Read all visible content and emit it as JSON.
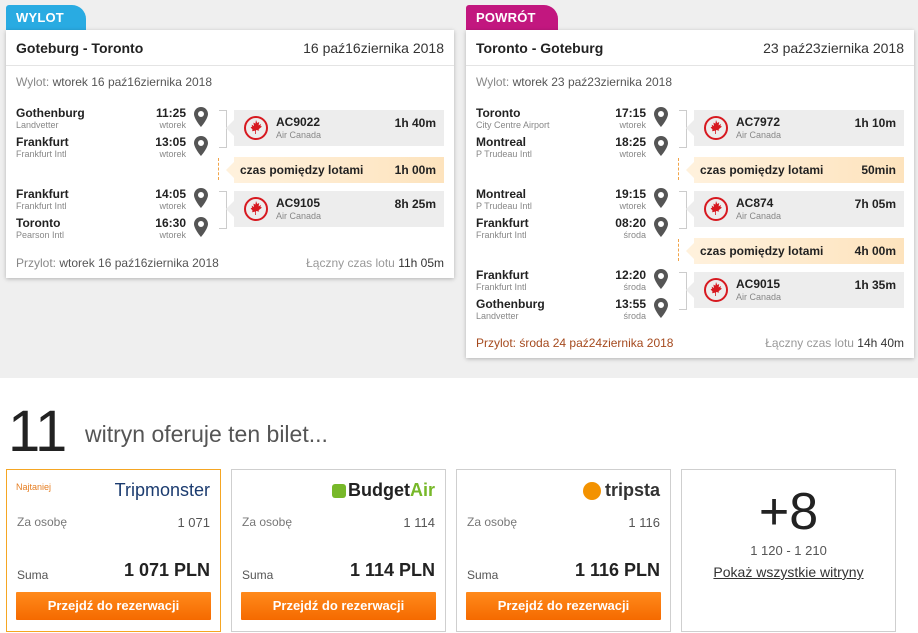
{
  "outbound": {
    "tag": "WYLOT",
    "route": "Goteburg - Toronto",
    "date": "16 paź16ziernika 2018",
    "departure_label": "Wylot:",
    "departure_value": "wtorek 16 paź16ziernika 2018",
    "arrival_label": "Przylot:",
    "arrival_value": "wtorek 16 paź16ziernika 2018",
    "total_label": "Łączny czas lotu",
    "total_value": "11h 05m",
    "stops": [
      {
        "city": "Gothenburg",
        "airport": "Landvetter",
        "time": "11:25",
        "day": "wtorek"
      },
      {
        "city": "Frankfurt",
        "airport": "Frankfurt Intl",
        "time": "13:05",
        "day": "wtorek"
      },
      {
        "city": "Frankfurt",
        "airport": "Frankfurt Intl",
        "time": "14:05",
        "day": "wtorek"
      },
      {
        "city": "Toronto",
        "airport": "Pearson Intl",
        "time": "16:30",
        "day": "wtorek"
      }
    ],
    "flights": [
      {
        "code": "AC9022",
        "airline": "Air Canada",
        "duration": "1h 40m"
      },
      {
        "code": "AC9105",
        "airline": "Air Canada",
        "duration": "8h 25m"
      }
    ],
    "layovers": [
      {
        "label": "czas pomiędzy lotami",
        "value": "1h 00m"
      }
    ]
  },
  "return": {
    "tag": "POWRÓT",
    "route": "Toronto - Goteburg",
    "date": "23 paź23ziernika 2018",
    "departure_label": "Wylot:",
    "departure_value": "wtorek 23 paź23ziernika 2018",
    "arrival_label": "Przylot:",
    "arrival_value": "środa 24 paź24ziernika 2018",
    "total_label": "Łączny czas lotu",
    "total_value": "14h 40m",
    "stops": [
      {
        "city": "Toronto",
        "airport": "City Centre Airport",
        "time": "17:15",
        "day": "wtorek"
      },
      {
        "city": "Montreal",
        "airport": "P Trudeau Intl",
        "time": "18:25",
        "day": "wtorek"
      },
      {
        "city": "Montreal",
        "airport": "P Trudeau Intl",
        "time": "19:15",
        "day": "wtorek"
      },
      {
        "city": "Frankfurt",
        "airport": "Frankfurt Intl",
        "time": "08:20",
        "day": "środa"
      },
      {
        "city": "Frankfurt",
        "airport": "Frankfurt Intl",
        "time": "12:20",
        "day": "środa"
      },
      {
        "city": "Gothenburg",
        "airport": "Landvetter",
        "time": "13:55",
        "day": "środa"
      }
    ],
    "flights": [
      {
        "code": "AC7972",
        "airline": "Air Canada",
        "duration": "1h 10m"
      },
      {
        "code": "AC874",
        "airline": "Air Canada",
        "duration": "7h 05m"
      },
      {
        "code": "AC9015",
        "airline": "Air Canada",
        "duration": "1h 35m"
      }
    ],
    "layovers": [
      {
        "label": "czas pomiędzy lotami",
        "value": "50min"
      },
      {
        "label": "czas pomiędzy lotami",
        "value": "4h 00m"
      }
    ]
  },
  "offers_summary": {
    "count": "11",
    "label": "witryn oferuje ten bilet..."
  },
  "offers": [
    {
      "badge": "Najtaniej",
      "site": "Tripmonster",
      "per_person_label": "Za osobę",
      "per_person": "1 071",
      "sum_label": "Suma",
      "sum": "1 071 PLN",
      "button": "Przejdź do rezerwacji"
    },
    {
      "badge": "",
      "site_part1": "Budget",
      "site_part2": "Air",
      "per_person_label": "Za osobę",
      "per_person": "1 114",
      "sum_label": "Suma",
      "sum": "1 114 PLN",
      "button": "Przejdź do rezerwacji"
    },
    {
      "badge": "",
      "site": "tripsta",
      "per_person_label": "Za osobę",
      "per_person": "1 116",
      "sum_label": "Suma",
      "sum": "1 116 PLN",
      "button": "Przejdź do rezerwacji"
    }
  ],
  "more_sites": {
    "count": "+8",
    "range": "1 120 - 1 210",
    "link": "Pokaż wszystkie witryny"
  },
  "colors": {
    "outbound_tag": "#29abe2",
    "return_tag": "#c2177f",
    "button_orange": "#f56a00",
    "air_canada_red": "#d71920"
  },
  "icons": {
    "stop_marker": "map-pin-icon",
    "airline_logo": "maple-leaf-icon"
  }
}
